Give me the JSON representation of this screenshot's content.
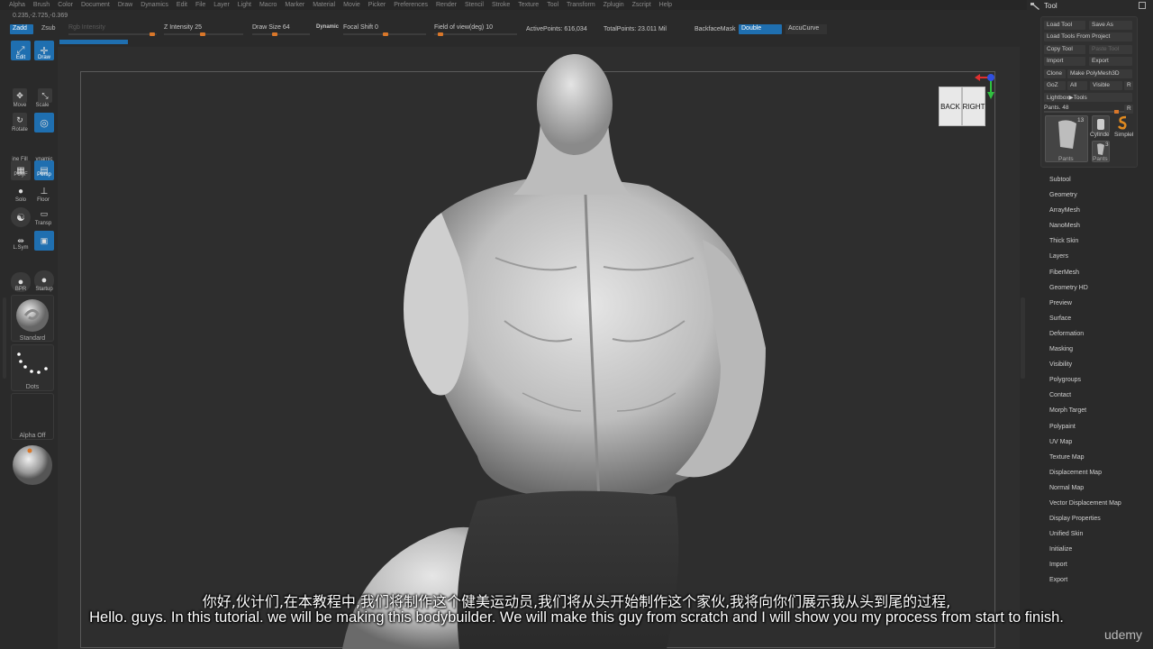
{
  "menu": [
    "Alpha",
    "Brush",
    "Color",
    "Document",
    "Draw",
    "Dynamics",
    "Edit",
    "File",
    "Layer",
    "Light",
    "Macro",
    "Marker",
    "Material",
    "Movie",
    "Picker",
    "Preferences",
    "Render",
    "Stencil",
    "Stroke",
    "Texture",
    "Tool",
    "Transform",
    "Zplugin",
    "Zscript",
    "Help"
  ],
  "coords": "0.235,-2.725,-0.369",
  "shelf": {
    "zadd": "Zadd",
    "zsub": "Zsub",
    "rgb_intensity": "Rgb Intensity",
    "z_intensity": "Z Intensity 25",
    "draw_size": "Draw Size 64",
    "dynamic": "Dynamic",
    "focal_shift": "Focal Shift 0",
    "fov": "Field of view(deg) 10",
    "active_points": "ActivePoints: 616,034",
    "total_points": "TotalPoints: 23.011 Mil",
    "backface_label": "BackfaceMask",
    "backface_value": "Double",
    "accucurve": "AccuCurve"
  },
  "left_tools": {
    "edit": "Edit",
    "draw": "Draw",
    "move": "Move",
    "scale": "Scale",
    "rotate": "Rotate",
    "inefill": "ine Fill",
    "dynamic": "ynamic",
    "polyf": "PolyF",
    "persp": "Persp",
    "solo": "Solo",
    "floor": "Floor",
    "transp": "Transp",
    "lsym": "L.Sym",
    "bpr": "BPR",
    "startup": "Startup",
    "standard": "Standard",
    "dots": "Dots",
    "alpha_off": "Alpha Off"
  },
  "navcube": {
    "back": "BACK",
    "right": "RIGHT"
  },
  "tool_panel": {
    "title": "Tool",
    "buttons": {
      "load_tool": "Load Tool",
      "save_as": "Save As",
      "load_from_project": "Load Tools From Project",
      "copy_tool": "Copy Tool",
      "paste_tool": "Paste Tool",
      "import": "Import",
      "export": "Export",
      "clone": "Clone",
      "make_polymesh": "Make PolyMesh3D",
      "goz": "GoZ",
      "all": "All",
      "visible": "Visible",
      "r1": "R",
      "lightbox": "Lightbox▶Tools",
      "r2": "R"
    },
    "pants_slider": "Pants. 48",
    "thumbs": {
      "count1": "13",
      "label1": "Pants",
      "label2": "Cylinde",
      "label3": "Simplel",
      "count2": "3",
      "label4": "Pants"
    },
    "sections": [
      "Subtool",
      "Geometry",
      "ArrayMesh",
      "NanoMesh",
      "Thick Skin",
      "Layers",
      "FiberMesh",
      "Geometry HD",
      "Preview",
      "Surface",
      "Deformation",
      "Masking",
      "Visibility",
      "Polygroups",
      "Contact",
      "Morph Target",
      "Polypaint",
      "UV Map",
      "Texture Map",
      "Displacement Map",
      "Normal Map",
      "Vector Displacement Map",
      "Display Properties",
      "Unified Skin",
      "Initialize",
      "Import",
      "Export"
    ]
  },
  "subtitles": {
    "cn": "你好,伙计们,在本教程中,我们将制作这个健美运动员,我们将从头开始制作这个家伙,我将向你们展示我从头到尾的过程,",
    "en": "Hello. guys. In this tutorial. we will be making this bodybuilder. We will make this guy from scratch and I will show you my process from start to finish."
  },
  "watermark": "udemy",
  "colors": {
    "accent": "#1f6fb0",
    "slider_knob": "#d9772a",
    "bg": "#2a2a2a"
  }
}
